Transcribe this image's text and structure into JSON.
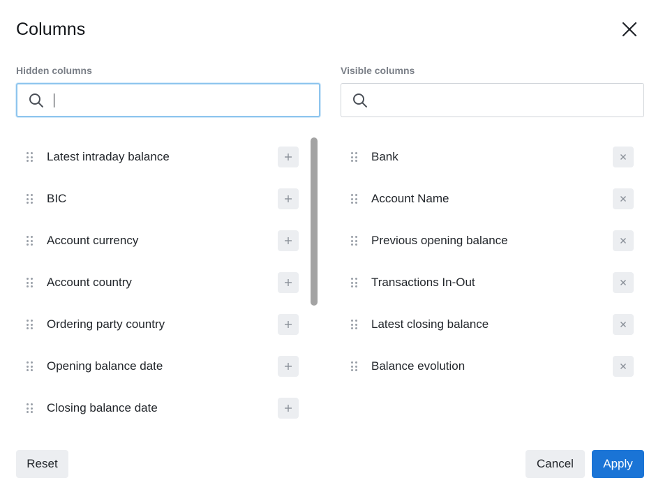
{
  "dialog": {
    "title": "Columns",
    "apply_label": "Apply",
    "cancel_label": "Cancel",
    "reset_label": "Reset"
  },
  "hidden": {
    "label": "Hidden columns",
    "search_value": "",
    "items": [
      {
        "label": "Latest intraday balance"
      },
      {
        "label": "BIC"
      },
      {
        "label": "Account currency"
      },
      {
        "label": "Account country"
      },
      {
        "label": "Ordering party country"
      },
      {
        "label": "Opening balance date"
      },
      {
        "label": "Closing balance date"
      }
    ]
  },
  "visible": {
    "label": "Visible columns",
    "search_value": "",
    "items": [
      {
        "label": "Bank"
      },
      {
        "label": "Account Name"
      },
      {
        "label": "Previous opening balance"
      },
      {
        "label": "Transactions In-Out"
      },
      {
        "label": "Latest closing balance"
      },
      {
        "label": "Balance evolution"
      }
    ]
  },
  "icons": {
    "close": "close-icon",
    "search": "search-icon",
    "add": "plus-icon",
    "remove": "x-icon",
    "drag": "drag-handle-icon"
  },
  "colors": {
    "accent": "#1a74d6",
    "focus_border": "#8ec5ee",
    "button_bg": "#eceef1"
  }
}
